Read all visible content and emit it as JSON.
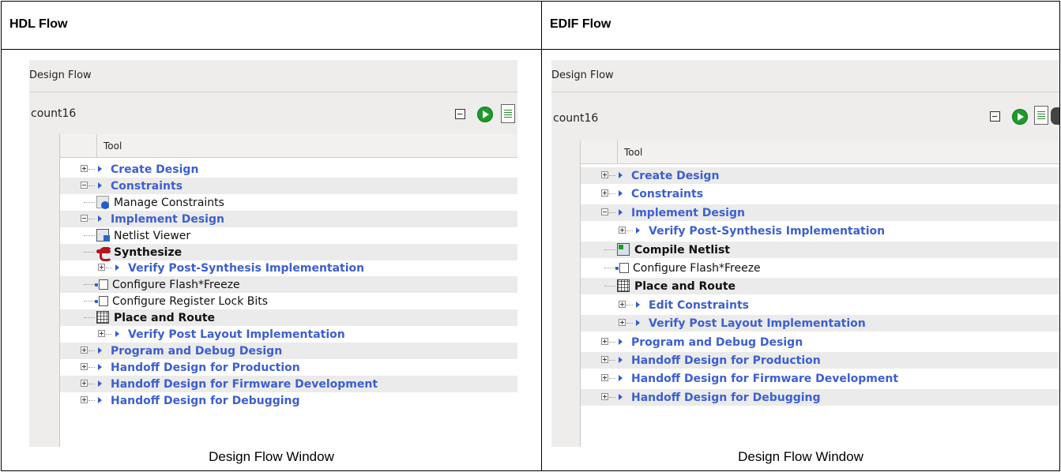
{
  "columns": {
    "hdl_title": "HDL Flow",
    "edif_title": "EDIF Flow"
  },
  "captions": {
    "hdl": "Design Flow Window",
    "edif": "Design Flow Window"
  },
  "hdl_panel": {
    "panel_title": "Design Flow",
    "design_name": "count16",
    "column_header": "Tool",
    "toolbar_icons": [
      "collapse-icon",
      "run-icon",
      "report-icon"
    ],
    "rows": [
      {
        "label": "Create Design",
        "kind": "category",
        "level": 0,
        "expander": "plus"
      },
      {
        "label": "Constraints",
        "kind": "category",
        "level": 0,
        "expander": "minus"
      },
      {
        "label": "Manage Constraints",
        "kind": "tool",
        "level": 1,
        "icon": "manage-constraints-icon"
      },
      {
        "label": "Implement Design",
        "kind": "category",
        "level": 0,
        "expander": "minus"
      },
      {
        "label": "Netlist Viewer",
        "kind": "tool",
        "level": 1,
        "icon": "netlist-viewer-icon"
      },
      {
        "label": "Synthesize",
        "kind": "tool-bold",
        "level": 1,
        "icon": "synthesize-icon"
      },
      {
        "label": "Verify Post-Synthesis Implementation",
        "kind": "category",
        "level": 1,
        "expander": "plus"
      },
      {
        "label": "Configure Flash*Freeze",
        "kind": "tool",
        "level": 1,
        "icon": "configure-icon"
      },
      {
        "label": "Configure Register Lock Bits",
        "kind": "tool",
        "level": 1,
        "icon": "configure-icon"
      },
      {
        "label": "Place and Route",
        "kind": "tool-bold",
        "level": 1,
        "icon": "place-route-icon"
      },
      {
        "label": "Verify Post Layout Implementation",
        "kind": "category",
        "level": 1,
        "expander": "plus"
      },
      {
        "label": "Program and Debug Design",
        "kind": "category",
        "level": 0,
        "expander": "plus"
      },
      {
        "label": "Handoff Design for Production",
        "kind": "category",
        "level": 0,
        "expander": "plus"
      },
      {
        "label": "Handoff Design for Firmware Development",
        "kind": "category",
        "level": 0,
        "expander": "plus"
      },
      {
        "label": "Handoff Design for Debugging",
        "kind": "category",
        "level": 0,
        "expander": "plus"
      }
    ]
  },
  "edif_panel": {
    "panel_title": "Design Flow",
    "design_name": "count16",
    "column_header": "Tool",
    "toolbar_icons": [
      "collapse-icon",
      "run-icon",
      "report-icon",
      "options-icon"
    ],
    "rows": [
      {
        "label": "Create Design",
        "kind": "category",
        "level": 0,
        "expander": "plus"
      },
      {
        "label": "Constraints",
        "kind": "category",
        "level": 0,
        "expander": "plus"
      },
      {
        "label": "Implement Design",
        "kind": "category",
        "level": 0,
        "expander": "minus"
      },
      {
        "label": "Verify Post-Synthesis Implementation",
        "kind": "category",
        "level": 1,
        "expander": "plus"
      },
      {
        "label": "Compile Netlist",
        "kind": "tool-bold",
        "level": 1,
        "icon": "compile-netlist-icon"
      },
      {
        "label": "Configure Flash*Freeze",
        "kind": "tool",
        "level": 1,
        "icon": "configure-icon"
      },
      {
        "label": "Place and Route",
        "kind": "tool-bold",
        "level": 1,
        "icon": "place-route-icon"
      },
      {
        "label": "Edit Constraints",
        "kind": "category",
        "level": 1,
        "expander": "plus"
      },
      {
        "label": "Verify Post Layout Implementation",
        "kind": "category",
        "level": 1,
        "expander": "plus"
      },
      {
        "label": "Program and Debug Design",
        "kind": "category",
        "level": 0,
        "expander": "plus"
      },
      {
        "label": "Handoff Design for Production",
        "kind": "category",
        "level": 0,
        "expander": "plus"
      },
      {
        "label": "Handoff Design for Firmware Development",
        "kind": "category",
        "level": 0,
        "expander": "plus"
      },
      {
        "label": "Handoff Design for Debugging",
        "kind": "category",
        "level": 0,
        "expander": "plus"
      }
    ]
  },
  "colors": {
    "category_text": "#3c5fd0",
    "run_button": "#1f9a2c",
    "panel_background": "#eeedeb"
  }
}
